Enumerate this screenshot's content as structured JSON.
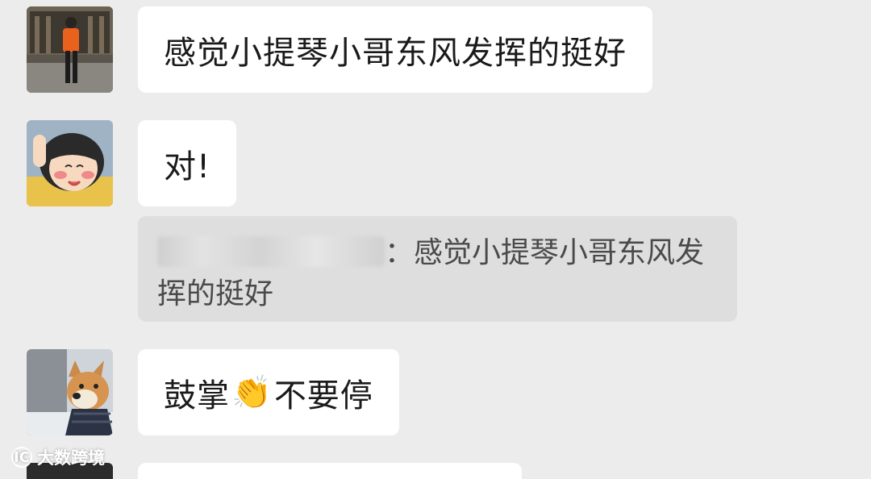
{
  "messages": [
    {
      "text": "感觉小提琴小哥东风发挥的挺好"
    },
    {
      "text": "对!"
    },
    {
      "text_before": "鼓掌",
      "emoji": "👏",
      "text_after": "不要停"
    }
  ],
  "quote": {
    "text": "：感觉小提琴小哥东风发挥的挺好"
  },
  "watermark": {
    "logo": "IC",
    "text": "大数跨境"
  },
  "colors": {
    "background": "#ececec",
    "bubble": "#ffffff",
    "quote_bg": "#dedede",
    "text": "#1a1a1a",
    "quote_text": "#4a4a4a"
  }
}
